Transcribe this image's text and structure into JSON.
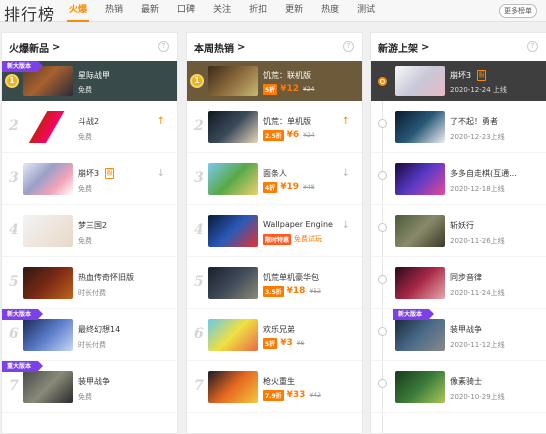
{
  "header": {
    "title": "排行榜",
    "tabs": [
      "火爆",
      "热销",
      "最新",
      "口碑",
      "关注",
      "折扣",
      "更新",
      "热度",
      "测试"
    ],
    "active_tab": "火爆",
    "more_button": "更多榜单"
  },
  "panels": {
    "hot": {
      "title": "火爆新品",
      "items": [
        {
          "rank": "1",
          "name": "星际战甲",
          "price": "免费",
          "ribbon": "新大版本"
        },
        {
          "rank": "2",
          "name": "斗战2",
          "price": "免费",
          "trend": "up"
        },
        {
          "rank": "3",
          "name": "崩坏3",
          "price": "免费",
          "trend": "down",
          "tag": "服"
        },
        {
          "rank": "4",
          "name": "梦三国2",
          "price": "免费"
        },
        {
          "rank": "5",
          "name": "热血传奇怀旧版",
          "price": "时长付费"
        },
        {
          "rank": "6",
          "name": "最终幻想14",
          "price": "时长付费",
          "ribbon": "新大版本"
        },
        {
          "rank": "7",
          "name": "装甲战争",
          "price": "免费",
          "ribbon": "重大版本"
        }
      ]
    },
    "bestsell": {
      "title": "本周热销",
      "items": [
        {
          "rank": "1",
          "name": "饥荒：联机版",
          "discount": "5折",
          "price": "¥12",
          "old_price": "¥24"
        },
        {
          "rank": "2",
          "name": "饥荒：单机版",
          "discount": "2.5折",
          "price": "¥6",
          "old_price": "¥24",
          "trend": "up"
        },
        {
          "rank": "3",
          "name": "面条人",
          "discount": "4折",
          "price": "¥19",
          "old_price": "¥48",
          "trend": "down"
        },
        {
          "rank": "4",
          "name": "Wallpaper Engine",
          "discount": "限时特惠",
          "price": "免费试玩",
          "trend": "down"
        },
        {
          "rank": "5",
          "name": "饥荒单机豪华包",
          "discount": "3.5折",
          "price": "¥18",
          "old_price": "¥52"
        },
        {
          "rank": "6",
          "name": "欢乐兄弟",
          "discount": "5折",
          "price": "¥3",
          "old_price": "¥6"
        },
        {
          "rank": "7",
          "name": "枪火重生",
          "discount": "7.9折",
          "price": "¥33",
          "old_price": "¥42"
        }
      ]
    },
    "newgames": {
      "title": "新游上架",
      "items": [
        {
          "name": "崩坏3",
          "date": "2020-12-24 上线",
          "tag": "服"
        },
        {
          "name": "了不起！勇者",
          "date": "2020-12-23上线"
        },
        {
          "name": "多多自走棋(互通...",
          "date": "2020-12-18上线"
        },
        {
          "name": "斩妖行",
          "date": "2020-11-26上线"
        },
        {
          "name": "同步音律",
          "date": "2020-11-24上线"
        },
        {
          "name": "装甲战争",
          "date": "2020-11-12上线",
          "ribbon": "新大版本"
        },
        {
          "name": "像素骑士",
          "date": "2020-10-29上线"
        }
      ]
    }
  },
  "icons": {
    "help": "?",
    "chevron": ">",
    "medal": "1",
    "arrow_up": "↑",
    "arrow_down": "↓"
  },
  "colors": {
    "accent": "#ff8a00",
    "ribbon": "#7d3fe8",
    "discount": "#ff7a00"
  }
}
